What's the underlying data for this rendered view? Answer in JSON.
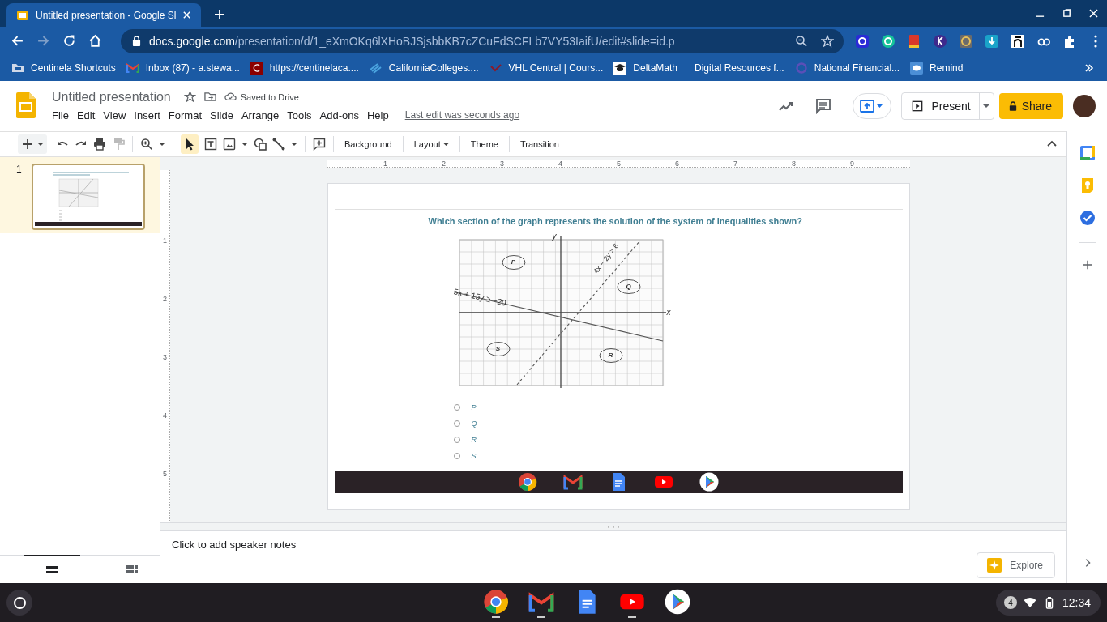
{
  "browser": {
    "tab": {
      "title": "Untitled presentation - Google Sl"
    },
    "url": {
      "host": "docs.google.com",
      "path": "/presentation/d/1_eXmOKq6lXHoBJSjsbbKB7cZCuFdSCFLb7VY53IaifU/edit#slide=id.p"
    },
    "bookmarks": [
      {
        "kind": "folder",
        "label": "Centinela Shortcuts"
      },
      {
        "kind": "mail",
        "label": "Inbox (87) - a.stewa..."
      },
      {
        "kind": "letter",
        "label": "https://centinelaca...."
      },
      {
        "kind": "stripes",
        "label": "CaliforniaColleges...."
      },
      {
        "kind": "check",
        "label": "VHL Central | Cours..."
      },
      {
        "kind": "cap",
        "label": "DeltaMath"
      },
      {
        "kind": "none",
        "label": "Digital Resources f..."
      },
      {
        "kind": "ring",
        "label": "National Financial..."
      },
      {
        "kind": "bubble",
        "label": "Remind"
      }
    ]
  },
  "docs": {
    "title": "Untitled presentation",
    "save_status": "Saved to Drive",
    "menu": [
      "File",
      "Edit",
      "View",
      "Insert",
      "Format",
      "Slide",
      "Arrange",
      "Tools",
      "Add-ons",
      "Help"
    ],
    "last_edit": "Last edit was seconds ago",
    "present": "Present",
    "share": "Share"
  },
  "toolbar": {
    "select_tool": {
      "selected": true
    },
    "buttons": [
      {
        "label": "Background",
        "caret": false
      },
      {
        "label": "Layout",
        "caret": true
      },
      {
        "label": "Theme",
        "caret": false
      },
      {
        "label": "Transition",
        "caret": false
      }
    ]
  },
  "ruler": {
    "horizontal": [
      "1",
      "2",
      "3",
      "4",
      "5",
      "6",
      "7",
      "8",
      "9"
    ],
    "vertical": [
      "1",
      "2",
      "3",
      "4",
      "5"
    ]
  },
  "filmstrip": {
    "slides": [
      {
        "number": "1",
        "selected": true
      }
    ],
    "views": [
      {
        "kind": "list",
        "selected": true
      },
      {
        "kind": "grid",
        "selected": false
      }
    ]
  },
  "slide": {
    "question": "Which section of the graph represents the solution of the system of inequalities shown?",
    "graph": {
      "x_label": "x",
      "y_label": "y",
      "solid_line_label": "5x + 15y ≥ −20",
      "dashed_line_label": "4x − 2y > 6",
      "regions": [
        {
          "label": "P"
        },
        {
          "label": "Q"
        },
        {
          "label": "R"
        },
        {
          "label": "S"
        }
      ]
    },
    "options": [
      {
        "label": "P",
        "selected": false
      },
      {
        "label": "Q",
        "selected": false
      },
      {
        "label": "R",
        "selected": false
      },
      {
        "label": "S",
        "selected": false
      }
    ]
  },
  "notes": {
    "placeholder": "Click to add speaker notes"
  },
  "explore": "Explore",
  "shelf": {
    "notifications": "4",
    "time": "12:34"
  }
}
